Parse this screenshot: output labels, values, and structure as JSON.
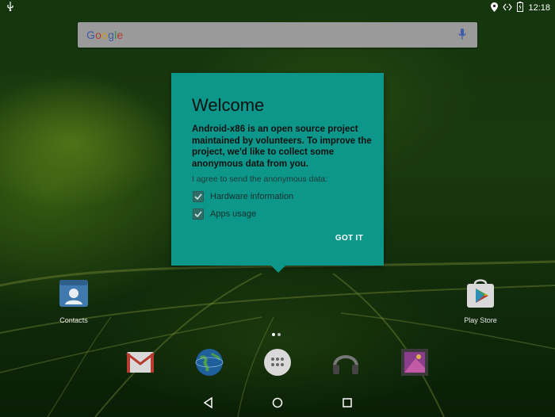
{
  "status_bar": {
    "time": "12:18",
    "icons": [
      "usb-icon",
      "location-icon",
      "data-sync-icon",
      "battery-icon"
    ]
  },
  "search_bar": {
    "logo_text": "Google",
    "icons": [
      "mic-icon"
    ]
  },
  "welcome_dialog": {
    "title": "Welcome",
    "body": "Android-x86 is an open source project maintained by volunteers. To improve the project, we'd like to collect some anonymous data from you.",
    "agree_text": "I agree to send the anonymous data:",
    "options": [
      {
        "label": "Hardware information",
        "checked": true
      },
      {
        "label": "Apps usage",
        "checked": true
      }
    ],
    "confirm_button": "GOT IT",
    "color": "#0d968a"
  },
  "desktop_apps": [
    {
      "label": "Contacts",
      "icon": "contacts-icon"
    },
    {
      "label": "Play Store",
      "icon": "play-store-icon"
    }
  ],
  "page_indicator": {
    "pages": 2,
    "current": 1
  },
  "dock": [
    {
      "icon": "gmail-icon"
    },
    {
      "icon": "browser-globe-icon"
    },
    {
      "icon": "all-apps-icon"
    },
    {
      "icon": "headphones-music-icon"
    },
    {
      "icon": "gallery-icon"
    }
  ],
  "nav_bar": [
    "back-icon",
    "home-icon",
    "recents-icon"
  ]
}
